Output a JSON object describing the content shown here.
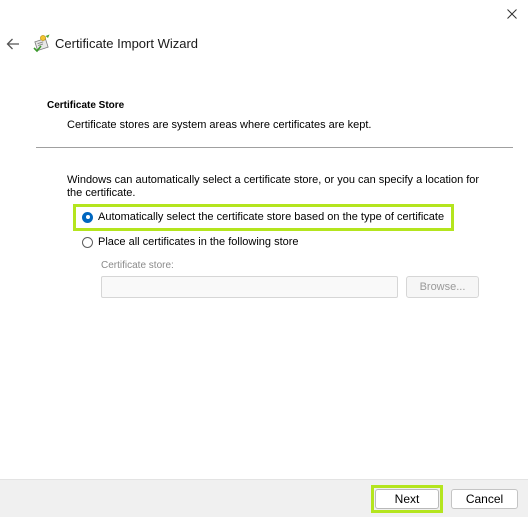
{
  "window": {
    "title": "Certificate Import Wizard",
    "close_icon": "close-icon",
    "back_icon": "back-arrow-icon",
    "wizard_icon": "certificate-wizard-icon"
  },
  "header": {
    "section_title": "Certificate Store",
    "description": "Certificate stores are system areas where certificates are kept."
  },
  "body": {
    "intro": "Windows can automatically select a certificate store, or you can specify a location for the certificate.",
    "options": [
      {
        "label": "Automatically select the certificate store based on the type of certificate",
        "selected": true
      },
      {
        "label": "Place all certificates in the following store",
        "selected": false
      }
    ],
    "store_field": {
      "label": "Certificate store:",
      "value": "",
      "enabled": false
    },
    "browse_label": "Browse..."
  },
  "footer": {
    "next_label": "Next",
    "cancel_label": "Cancel"
  },
  "colors": {
    "accent": "#0067c0",
    "highlight": "#b4e51e",
    "footer_bg": "#f0f0f0"
  }
}
